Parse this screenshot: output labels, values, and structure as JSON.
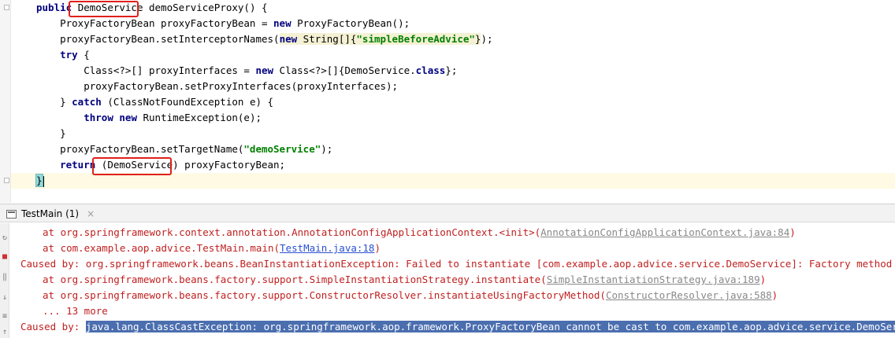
{
  "editor": {
    "lines": [
      {
        "segments": [
          {
            "t": "public",
            "c": "kw"
          },
          {
            "t": " "
          },
          {
            "t": "DemoService"
          },
          {
            "t": " demoServiceProxy() {"
          }
        ]
      },
      {
        "segments": [
          {
            "t": "    ProxyFactoryBean proxyFactoryBean = "
          },
          {
            "t": "new",
            "c": "kw"
          },
          {
            "t": " ProxyFactoryBean();"
          }
        ]
      },
      {
        "segments": [
          {
            "t": "    proxyFactoryBean.setInterceptorNames("
          },
          {
            "t": "new",
            "c": "kw hl-bg"
          },
          {
            "t": " String[]{",
            "c": "hl-bg"
          },
          {
            "t": "\"simpleBeforeAdvice\"",
            "c": "str hl-bg"
          },
          {
            "t": "}",
            "c": "hl-bg"
          },
          {
            "t": ");"
          }
        ]
      },
      {
        "segments": [
          {
            "t": "    "
          },
          {
            "t": "try",
            "c": "kw"
          },
          {
            "t": " {"
          }
        ]
      },
      {
        "segments": [
          {
            "t": "        Class<?>[] proxyInterfaces = "
          },
          {
            "t": "new",
            "c": "kw"
          },
          {
            "t": " Class<?>[]{DemoService."
          },
          {
            "t": "class",
            "c": "kw"
          },
          {
            "t": "};"
          }
        ]
      },
      {
        "segments": [
          {
            "t": "        proxyFactoryBean.setProxyInterfaces(proxyInterfaces);"
          }
        ]
      },
      {
        "segments": [
          {
            "t": "    } "
          },
          {
            "t": "catch",
            "c": "kw"
          },
          {
            "t": " (ClassNotFoundException e) {"
          }
        ]
      },
      {
        "segments": [
          {
            "t": "        "
          },
          {
            "t": "throw",
            "c": "kw"
          },
          {
            "t": " "
          },
          {
            "t": "new",
            "c": "kw"
          },
          {
            "t": " RuntimeException(e);"
          }
        ]
      },
      {
        "segments": [
          {
            "t": "    }"
          }
        ]
      },
      {
        "segments": [
          {
            "t": "    proxyFactoryBean.setTargetName("
          },
          {
            "t": "\"demoService\"",
            "c": "str"
          },
          {
            "t": ");"
          }
        ]
      },
      {
        "segments": [
          {
            "t": "    "
          },
          {
            "t": "return",
            "c": "kw"
          },
          {
            "t": " (DemoService) proxyFactoryBean;"
          }
        ]
      },
      {
        "segments": [
          {
            "t": "}",
            "c": "brace-match"
          }
        ]
      }
    ]
  },
  "run_panel": {
    "tab_label": "TestMain (1)",
    "close_glyph": "×"
  },
  "console": {
    "lines": [
      {
        "indent": true,
        "segments": [
          {
            "t": "at org.springframework.context.annotation.AnnotationConfigApplicationContext.<init>("
          },
          {
            "t": "AnnotationConfigApplicationContext.java:84",
            "c": "link"
          },
          {
            "t": ")"
          }
        ]
      },
      {
        "indent": true,
        "segments": [
          {
            "t": "at com.example.aop.advice.TestMain.main("
          },
          {
            "t": "TestMain.java:18",
            "c": "link-blue"
          },
          {
            "t": ")"
          }
        ]
      },
      {
        "indent": false,
        "segments": [
          {
            "t": "Caused by: org.springframework.beans.BeanInstantiationException: Failed to instantiate [com.example.aop.advice.service.DemoService]: Factory method 'demoServic"
          }
        ]
      },
      {
        "indent": true,
        "segments": [
          {
            "t": "at org.springframework.beans.factory.support.SimpleInstantiationStrategy.instantiate("
          },
          {
            "t": "SimpleInstantiationStrategy.java:189",
            "c": "link"
          },
          {
            "t": ")"
          }
        ]
      },
      {
        "indent": true,
        "segments": [
          {
            "t": "at org.springframework.beans.factory.support.ConstructorResolver.instantiateUsingFactoryMethod("
          },
          {
            "t": "ConstructorResolver.java:588",
            "c": "link"
          },
          {
            "t": ")"
          }
        ]
      },
      {
        "indent": true,
        "segments": [
          {
            "t": "... 13 more"
          }
        ]
      },
      {
        "indent": false,
        "segments": [
          {
            "t": "Caused by: "
          },
          {
            "t": "java.lang.ClassCastException: org.springframework.aop.framework.ProxyFactoryBean cannot be cast to com.example.aop.advice.service.DemoService",
            "c": "sel"
          }
        ]
      }
    ]
  },
  "colors": {
    "keyword": "#000080",
    "string": "#008000",
    "error_text": "#c02020",
    "selection": "#4b6eaf",
    "annotation_box": "#e0201b",
    "caret_line": "#fffae3"
  },
  "icons": [
    "run-tab-icon",
    "close-icon",
    "fold-icon",
    "stop-icon",
    "rerun-icon",
    "scroll-down-icon",
    "print-icon"
  ]
}
